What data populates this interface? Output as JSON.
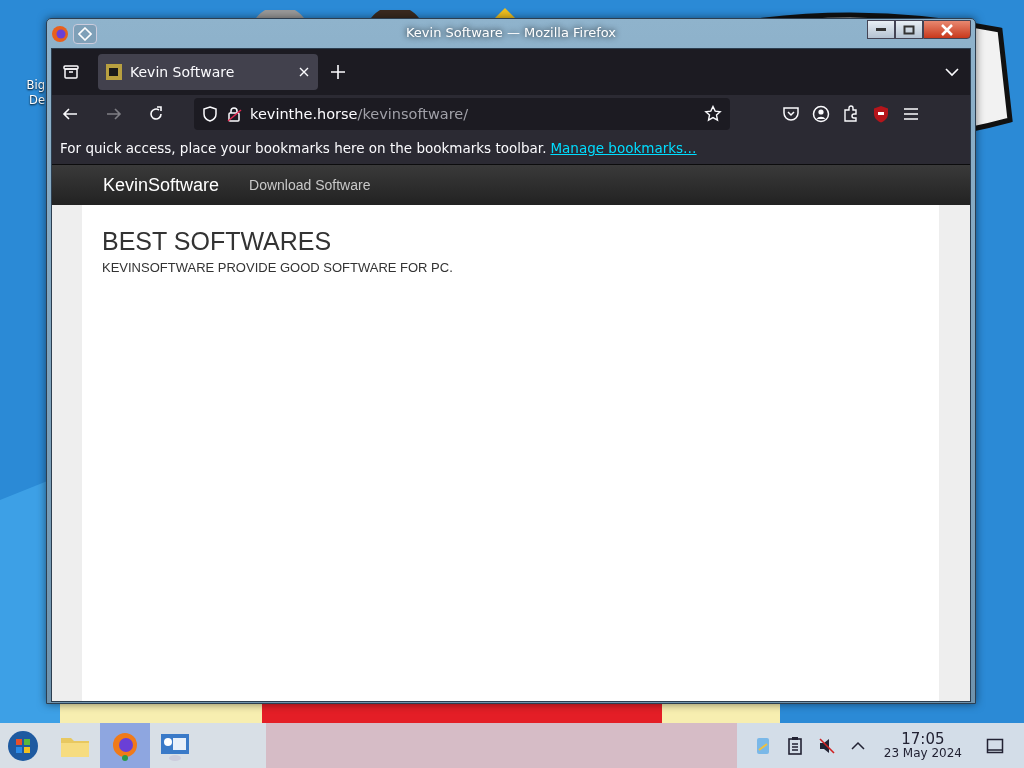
{
  "window": {
    "title": "Kevin Software — Mozilla Firefox"
  },
  "desktop": {
    "icon_label": [
      "Big",
      "De"
    ]
  },
  "tabs": [
    {
      "title": "Kevin Software",
      "selected": true
    }
  ],
  "navigation": {
    "forward_disabled": true
  },
  "address_bar": {
    "host": "kevinthe.horse",
    "path": "/kevinsoftware/"
  },
  "bookmarks_bar": {
    "message": "For quick access, place your bookmarks here on the bookmarks toolbar.",
    "link": "Manage bookmarks…"
  },
  "site": {
    "brand": "KevinSoftware",
    "nav": [
      {
        "label": "Download Software"
      }
    ],
    "heading": "BEST SOFTWARES",
    "subheading": "KEVINSOFTWARE PROVIDE GOOD SOFTWARE FOR PC."
  },
  "taskbar": {
    "apps": [
      {
        "kind": "folder",
        "active": false
      },
      {
        "kind": "browser",
        "active": true
      },
      {
        "kind": "monitor",
        "active": false
      }
    ],
    "volume_muted": true,
    "time": "17:05",
    "date": "23 May 2024"
  }
}
